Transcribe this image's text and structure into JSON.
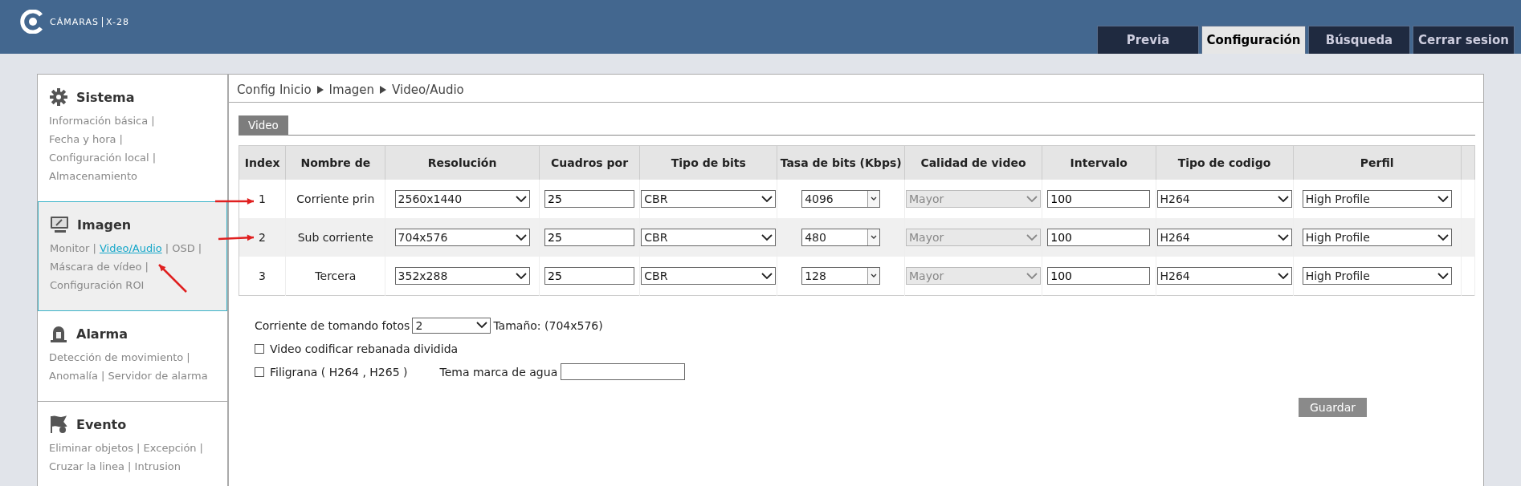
{
  "header": {
    "brand": "CÁMARAS",
    "model": "X-28"
  },
  "nav_tabs": [
    {
      "label": "Previa",
      "selected": false
    },
    {
      "label": "Configuración",
      "selected": true
    },
    {
      "label": "Búsqueda",
      "selected": false
    },
    {
      "label": "Cerrar sesion",
      "selected": false
    }
  ],
  "sidebar": {
    "sections": [
      {
        "title": "Sistema",
        "kind": "gear",
        "selected": false,
        "links": [
          {
            "label": "Información básica",
            "sep": "|",
            "selected": false
          },
          {
            "label": "Fecha y hora",
            "sep": "|",
            "selected": false
          },
          {
            "label": "Configuración local",
            "sep": "|",
            "selected": false
          },
          {
            "label": "Almacenamiento",
            "selected": false
          }
        ]
      },
      {
        "title": "Imagen",
        "kind": "monitor",
        "selected": true,
        "links": [
          {
            "label": "Monitor",
            "sep": "|",
            "selected": false
          },
          {
            "label": "Video/Audio",
            "sep": "|",
            "selected": true
          },
          {
            "label": "OSD",
            "sep": "|",
            "selected": false
          },
          {
            "label": "Máscara de vídeo",
            "sep": "|",
            "selected": false
          },
          {
            "label": "Configuración ROI",
            "selected": false
          }
        ]
      },
      {
        "title": "Alarma",
        "kind": "alarm",
        "selected": false,
        "links": [
          {
            "label": "Detección de movimiento",
            "sep": "|",
            "selected": false
          },
          {
            "label": "Anomalía",
            "sep": "|",
            "selected": false
          },
          {
            "label": "Servidor de alarma",
            "selected": false
          }
        ]
      },
      {
        "title": "Evento",
        "kind": "flag",
        "selected": false,
        "links": [
          {
            "label": "Eliminar objetos",
            "sep": "|",
            "selected": false
          },
          {
            "label": "Excepción",
            "sep": "|",
            "selected": false
          },
          {
            "label": "Cruzar la linea",
            "sep": "|",
            "selected": false
          },
          {
            "label": "Intrusion",
            "selected": false
          }
        ]
      }
    ]
  },
  "breadcrumb": [
    "Config Inicio",
    "Imagen",
    "Video/Audio"
  ],
  "subtabs": [
    {
      "label": "Video",
      "selected": true
    }
  ],
  "table": {
    "columns": [
      "Index",
      "Nombre de",
      "Resolución",
      "Cuadros por",
      "Tipo de bits",
      "Tasa de bits (Kbps)",
      "Calidad de video",
      "Intervalo",
      "Tipo de codigo",
      "Perfil"
    ],
    "rows": [
      [
        {
          "kind": "text",
          "value": "1"
        },
        {
          "kind": "text",
          "value": "Corriente prin"
        },
        {
          "kind": "select",
          "value": "2560x1440",
          "disabled": false
        },
        {
          "kind": "input",
          "value": "25"
        },
        {
          "kind": "select",
          "value": "CBR",
          "disabled": false
        },
        {
          "kind": "combo",
          "value": "4096"
        },
        {
          "kind": "select",
          "value": "Mayor",
          "disabled": true
        },
        {
          "kind": "input",
          "value": "100"
        },
        {
          "kind": "select",
          "value": "H264",
          "disabled": false
        },
        {
          "kind": "select",
          "value": "High Profile",
          "disabled": false
        }
      ],
      [
        {
          "kind": "text",
          "value": "2"
        },
        {
          "kind": "text",
          "value": "Sub corriente"
        },
        {
          "kind": "select",
          "value": "704x576",
          "disabled": false
        },
        {
          "kind": "input",
          "value": "25"
        },
        {
          "kind": "select",
          "value": "CBR",
          "disabled": false
        },
        {
          "kind": "combo",
          "value": "480"
        },
        {
          "kind": "select",
          "value": "Mayor",
          "disabled": true
        },
        {
          "kind": "input",
          "value": "100"
        },
        {
          "kind": "select",
          "value": "H264",
          "disabled": false
        },
        {
          "kind": "select",
          "value": "High Profile",
          "disabled": false
        }
      ],
      [
        {
          "kind": "text",
          "value": "3"
        },
        {
          "kind": "text",
          "value": "Tercera"
        },
        {
          "kind": "select",
          "value": "352x288",
          "disabled": false
        },
        {
          "kind": "input",
          "value": "25"
        },
        {
          "kind": "select",
          "value": "CBR",
          "disabled": false
        },
        {
          "kind": "combo",
          "value": "128"
        },
        {
          "kind": "select",
          "value": "Mayor",
          "disabled": true
        },
        {
          "kind": "input",
          "value": "100"
        },
        {
          "kind": "select",
          "value": "H264",
          "disabled": false
        },
        {
          "kind": "select",
          "value": "High Profile",
          "disabled": false
        }
      ]
    ]
  },
  "snapshot": {
    "label": "Corriente de tomando fotos",
    "value": "2",
    "size": "Tamaño: (704x576)"
  },
  "slice_option": {
    "label": "Video codificar rebanada dividida",
    "checked": false
  },
  "watermark": {
    "label": "Filigrana ( H264 , H265 )",
    "checked": false,
    "theme_label": "Tema marca de agua"
  },
  "save_button": "Guardar"
}
